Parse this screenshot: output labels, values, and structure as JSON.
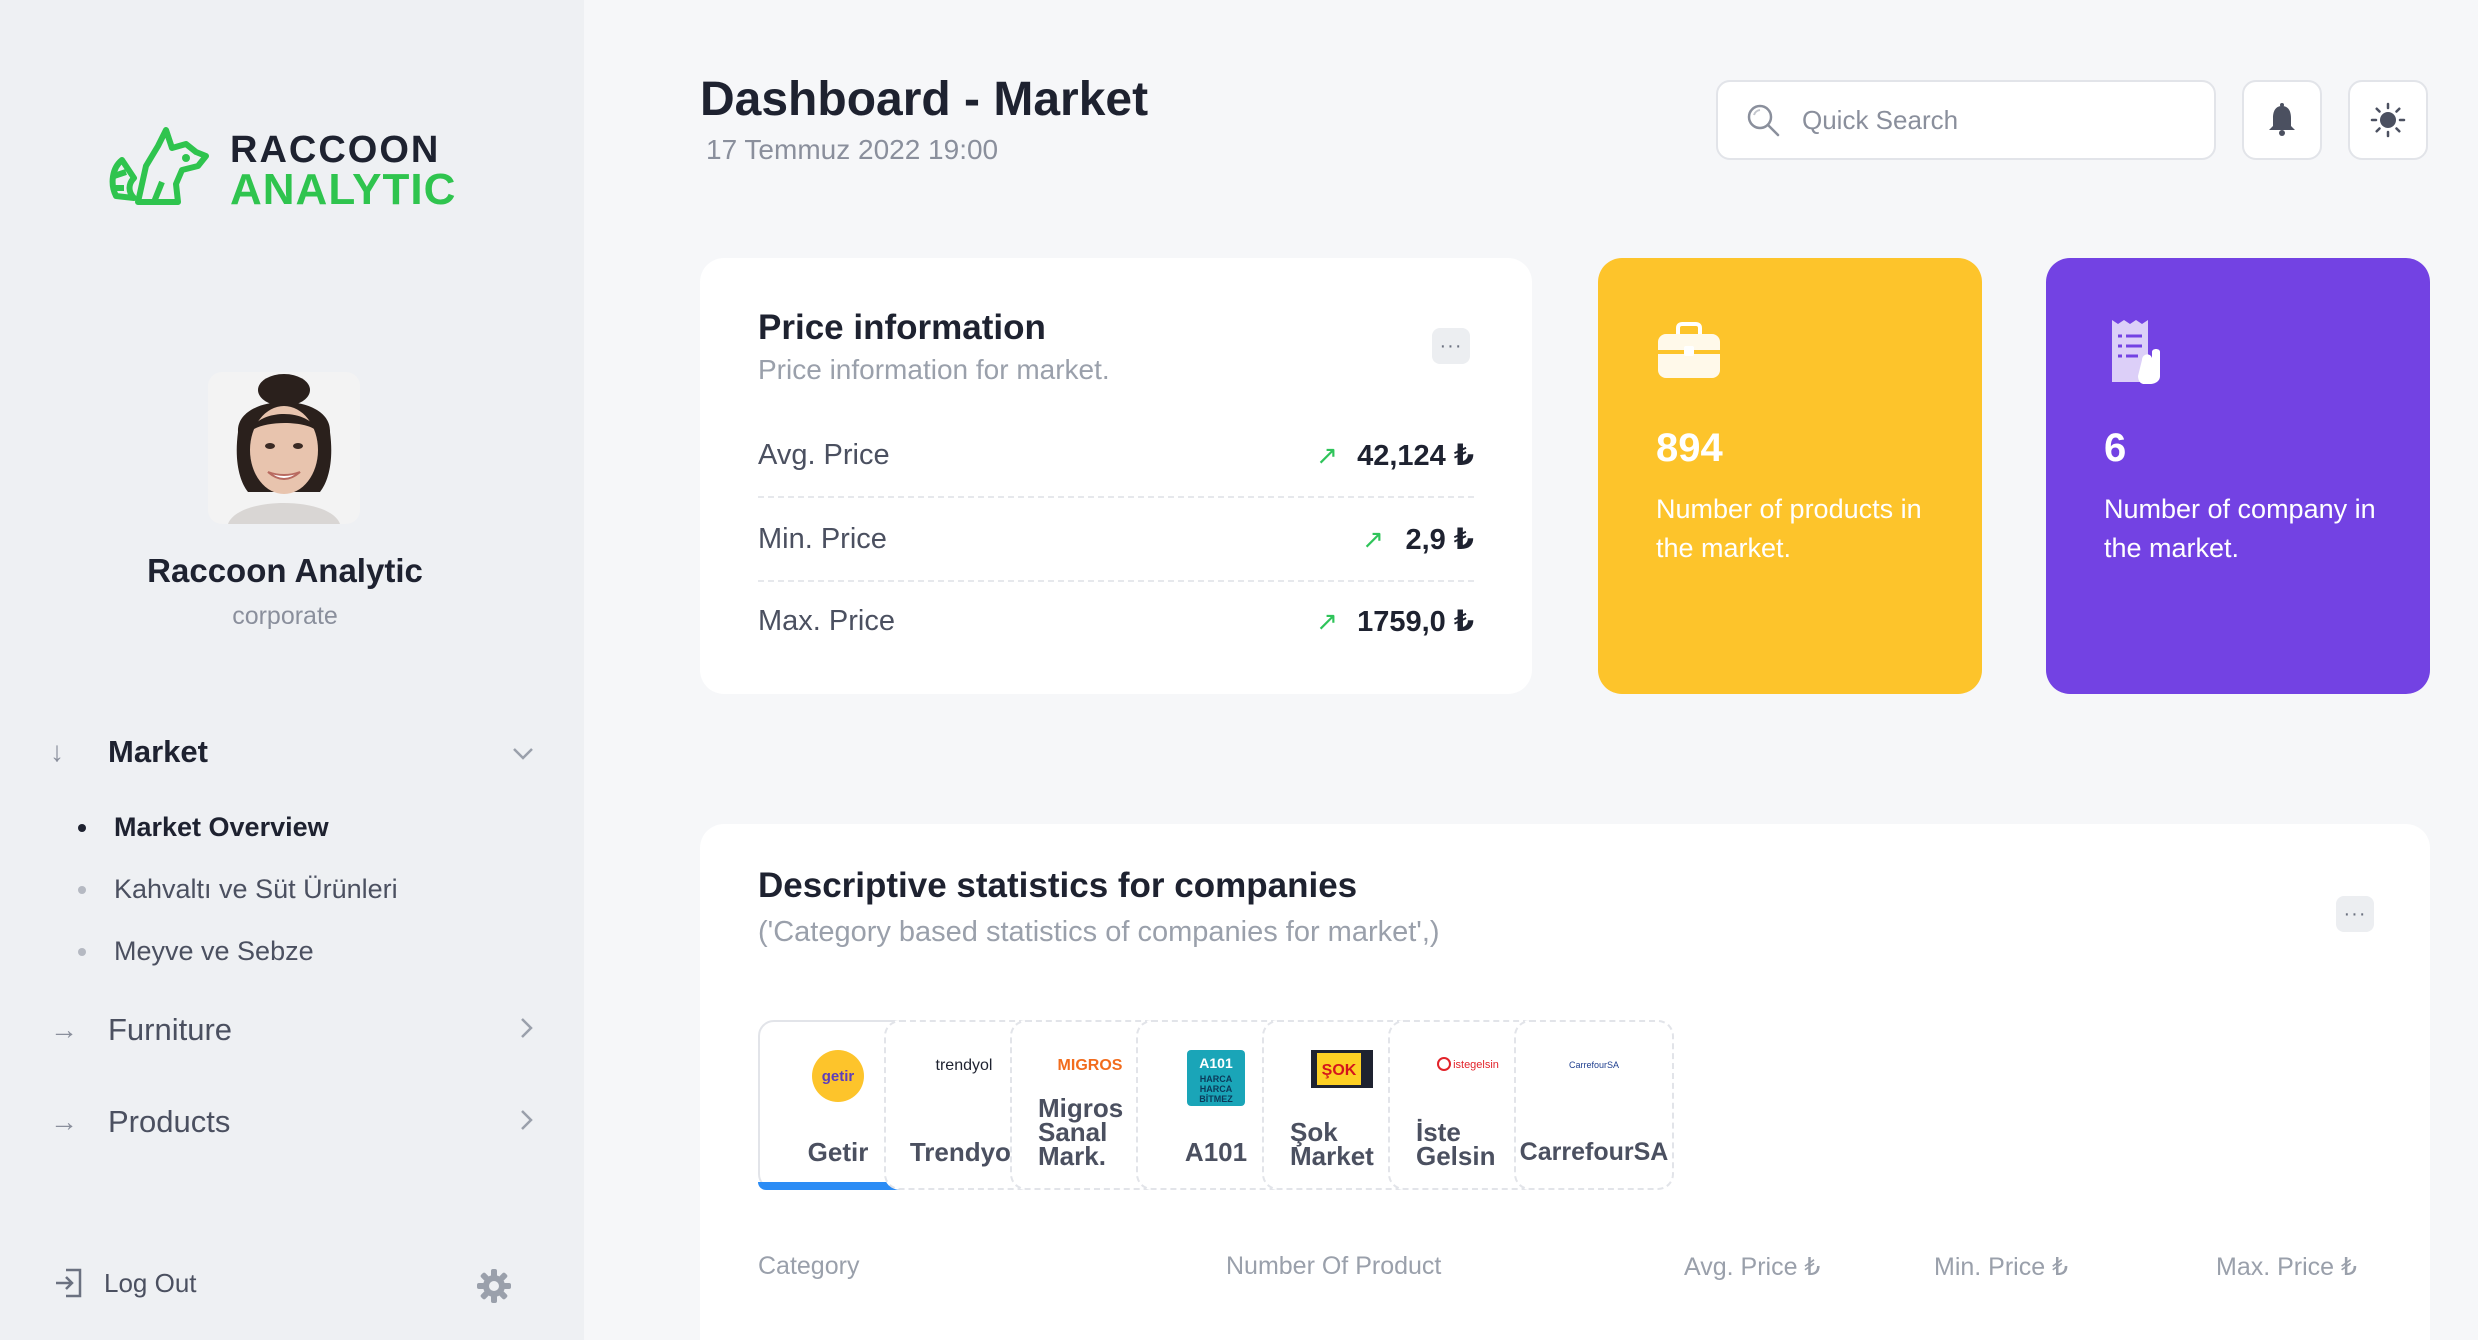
{
  "brand": {
    "line1": "RACCOON",
    "line2": "ANALYTIC"
  },
  "user": {
    "name": "Raccoon Analytic",
    "role": "corporate"
  },
  "nav": {
    "market": {
      "label": "Market",
      "arrow": "↓",
      "chevron": "⌄"
    },
    "sub_items": [
      {
        "label": "Market Overview",
        "active": true
      },
      {
        "label": "Kahvaltı ve Süt Ürünleri",
        "active": false
      },
      {
        "label": "Meyve ve Sebze",
        "active": false
      }
    ],
    "furniture": {
      "label": "Furniture",
      "arrow": "→",
      "chevron": "›"
    },
    "products": {
      "label": "Products",
      "arrow": "→",
      "chevron": "›"
    },
    "logout": "Log Out"
  },
  "header": {
    "title": "Dashboard - Market",
    "date": "17 Temmuz 2022 19:00",
    "search_placeholder": "Quick Search",
    "icons": [
      "search-icon",
      "bell-icon",
      "sun-icon"
    ]
  },
  "price_card": {
    "title": "Price information",
    "subtitle": "Price information for market.",
    "more": "···",
    "rows": [
      {
        "label": "Avg. Price",
        "value": "42,124 ₺",
        "trend": "↗"
      },
      {
        "label": "Min. Price",
        "value": "2,9 ₺",
        "trend": "↗"
      },
      {
        "label": "Max. Price",
        "value": "1759,0 ₺",
        "trend": "↗"
      }
    ]
  },
  "stats": [
    {
      "value": "894",
      "desc": "Number of products in the market.",
      "color": "#fdc42b",
      "icon": "briefcase-icon"
    },
    {
      "value": "6",
      "desc": "Number of company in the market.",
      "color": "#7342e3",
      "icon": "receipt-icon"
    }
  ],
  "descriptive": {
    "title": "Descriptive statistics for companies",
    "subtitle": "('Category based statistics of companies for market',)",
    "more": "···",
    "companies": [
      {
        "name": "Getir",
        "logo": "getir",
        "active": true
      },
      {
        "name": "Trendyol",
        "logo": "trendyol",
        "active": false
      },
      {
        "name": "Migros Sanal Mark.",
        "logo": "MIGROS",
        "active": false
      },
      {
        "name": "A101",
        "logo": "A101",
        "active": false
      },
      {
        "name": "Şok Market",
        "logo": "ŞOK",
        "active": false
      },
      {
        "name": "İste Gelsin",
        "logo": "istegelsin",
        "active": false
      },
      {
        "name": "CarrefourSA",
        "logo": "CarrefourSA",
        "active": false
      }
    ],
    "columns": [
      "Category",
      "Number Of Product",
      "Avg. Price ₺",
      "Min. Price ₺",
      "Max. Price ₺"
    ]
  },
  "colors": {
    "accent_green": "#2fc44e",
    "accent_blue": "#2b8cf5",
    "yellow": "#fdc42b",
    "purple": "#7342e3"
  }
}
